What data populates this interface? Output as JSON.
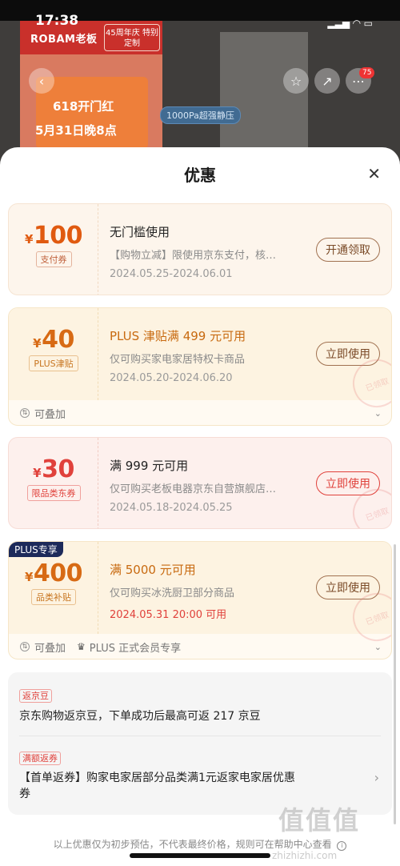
{
  "status_bar": {
    "time": "17:38"
  },
  "background": {
    "brand_logo": "ROBAM老板",
    "anniversary_badge": "45周年庆 特别定制",
    "promo_line1": "618开门红",
    "promo_line2": "5月31日晚8点",
    "feature_tag": "1000Pa超强静压",
    "notification_count": "75"
  },
  "sheet": {
    "title": "优惠",
    "close_icon": "close-icon"
  },
  "coupons": [
    {
      "currency": "¥",
      "amount": "100",
      "type": "支付券",
      "title": "无门槛使用",
      "desc": "【购物立减】限使用京东支付，核…",
      "date": "2024.05.25-2024.06.01",
      "button": "开通领取"
    },
    {
      "currency": "¥",
      "amount": "40",
      "type": "PLUS津贴",
      "title": "PLUS 津贴满 499 元可用",
      "desc": "仅可购买家电家居特权卡商品",
      "date": "2024.05.20-2024.06.20",
      "button": "立即使用",
      "footer": "可叠加"
    },
    {
      "currency": "¥",
      "amount": "30",
      "type": "限品类东券",
      "title": "满 999 元可用",
      "desc": "仅可购买老板电器京东自营旗舰店…",
      "date": "2024.05.18-2024.05.25",
      "button": "立即使用"
    },
    {
      "ribbon": "PLUS专享",
      "currency": "¥",
      "amount": "400",
      "type": "品类补贴",
      "title": "满 5000 元可用",
      "desc": "仅可购买冰洗厨卫部分商品",
      "date": "2024.05.31 20:00 可用",
      "button": "立即使用",
      "footer": "可叠加",
      "footer2": "PLUS 正式会员专享"
    }
  ],
  "stamp_text": "已领取",
  "jingdou": {
    "label": "返京豆",
    "text": "京东购物返京豆，下单成功后最高可返 217 京豆"
  },
  "rebate": {
    "label": "满额返券",
    "text": "【首单返券】购家电家居部分品类满1元返家电家居优惠券"
  },
  "note": "以上优惠仅为初步预估，不代表最终价格，规则可在帮助中心查看",
  "watermark": "值值值",
  "watermark_url": "zhizhizhi.com"
}
